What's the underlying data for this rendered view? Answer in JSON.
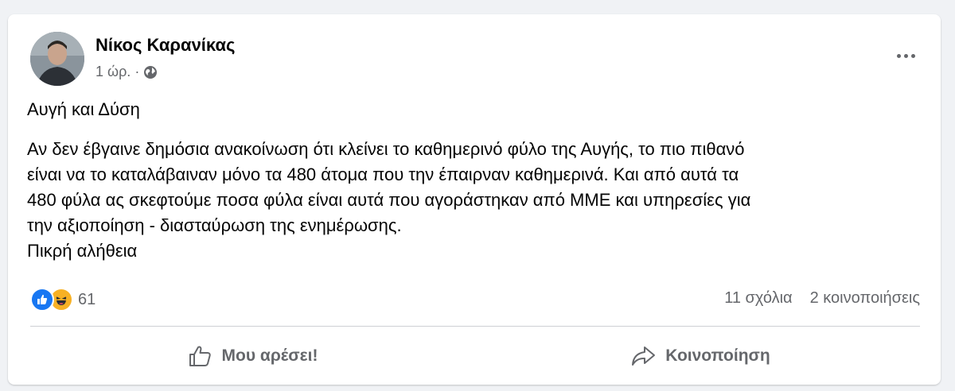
{
  "post": {
    "author": "Νίκος Καρανίκας",
    "time": "1 ώρ.",
    "separator": "·",
    "audience_icon": "globe-icon",
    "title": "Αυγή και Δύση",
    "body_lines": [
      "Αν δεν έβγαινε δημόσια ανακοίνωση ότι κλείνει το καθημερινό φύλο της Αυγής, το πιο πιθανό",
      "είναι να το καταλάβαιναν μόνο τα 480 άτομα που την έπαιρναν καθημερινά. Και από αυτά τα",
      "480 φύλα ας σκεφτούμε ποσα φύλα είναι αυτά που αγοράστηκαν από ΜΜΕ και υπηρεσίες για",
      "την αξιοποίηση - διασταύρωση της ενημέρωσης.",
      "Πικρή αλήθεια"
    ]
  },
  "reactions": {
    "icons": [
      "like-reaction-icon",
      "haha-reaction-icon"
    ],
    "count": "61"
  },
  "stats": {
    "comments": "11 σχόλια",
    "shares": "2 κοινοποιήσεις"
  },
  "actions": {
    "like_label": "Μου αρέσει!",
    "share_label": "Κοινοποίηση"
  },
  "colors": {
    "background": "#f0f2f5",
    "card": "#ffffff",
    "text": "#050505",
    "secondary_text": "#65676b",
    "like_blue": "#1877f2",
    "haha_yellow": "#f7b125"
  }
}
